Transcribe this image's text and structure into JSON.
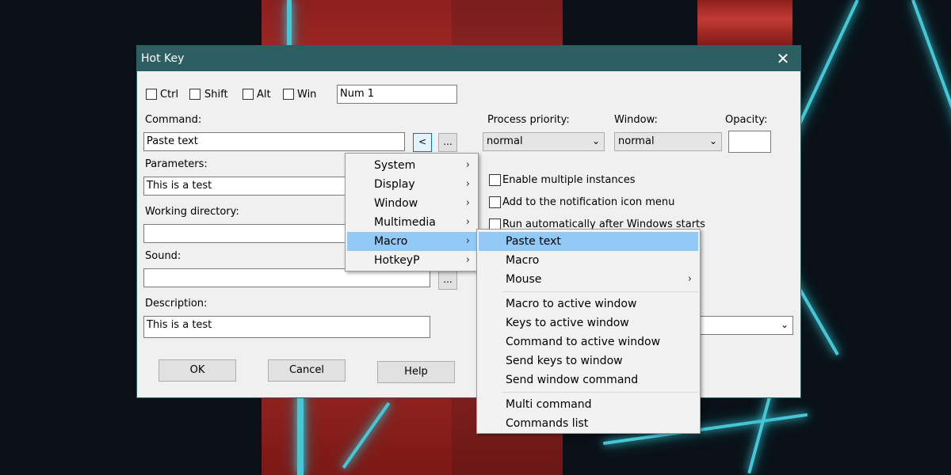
{
  "dialog": {
    "title": "Hot Key",
    "close_glyph": "✕",
    "modifiers": {
      "ctrl": "Ctrl",
      "shift": "Shift",
      "alt": "Alt",
      "win": "Win"
    },
    "key_value": "Num 1",
    "command_label": "Command:",
    "command_value": "Paste text",
    "insert_button": "<",
    "browse_button": "...",
    "parameters_label": "Parameters:",
    "parameters_value": "This is a test",
    "working_dir_label": "Working directory:",
    "working_dir_value": "",
    "sound_label": "Sound:",
    "sound_value": "",
    "description_label": "Description:",
    "description_value": "This is a test",
    "process_priority_label": "Process priority:",
    "process_priority_value": "normal",
    "window_label": "Window:",
    "window_value": "normal",
    "opacity_label": "Opacity:",
    "opacity_value": "",
    "enable_multiple": "Enable multiple instances",
    "add_notification": "Add to the notification icon menu",
    "run_auto": "Run automatically after Windows starts",
    "ok": "OK",
    "cancel": "Cancel",
    "help": "Help"
  },
  "menu": {
    "items": [
      "System",
      "Display",
      "Window",
      "Multimedia",
      "Macro",
      "HotkeyP"
    ],
    "highlighted": "Macro",
    "submenu_arrow": "›"
  },
  "submenu": {
    "group1": [
      "Paste text",
      "Macro",
      "Mouse"
    ],
    "group2": [
      "Macro to active window",
      "Keys to active window",
      "Command to active window",
      "Send keys to window",
      "Send window command"
    ],
    "group3": [
      "Multi command",
      "Commands list"
    ],
    "highlighted": "Paste text"
  },
  "colors": {
    "titlebar": "#2c5e62",
    "highlight": "#91c9f7",
    "dialog_bg": "#f0f0f0"
  }
}
